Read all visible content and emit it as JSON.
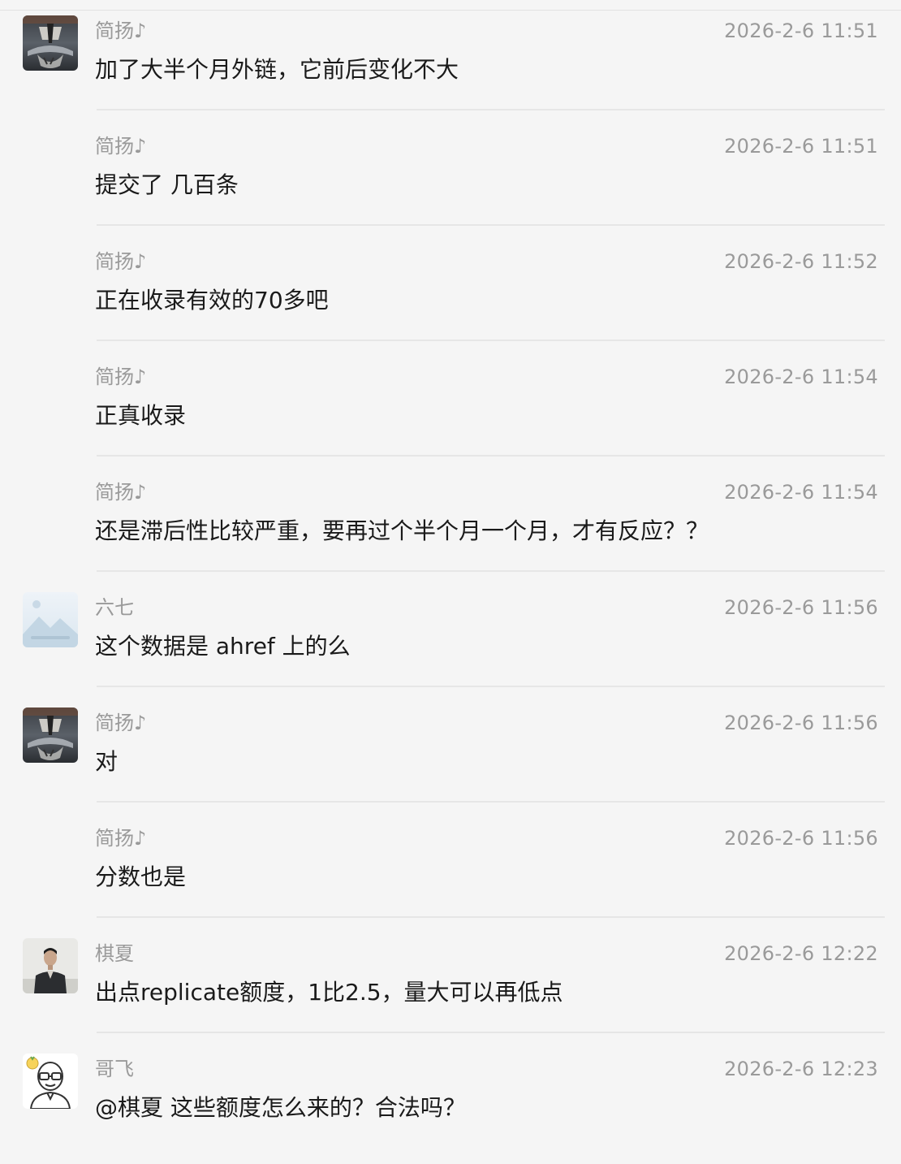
{
  "messages": [
    {
      "name": "简扬♪",
      "time": "2026-2-6 11:51",
      "text": "加了大半个月外链，它前后变化不大",
      "avatar": "tiger-reflection-avatar"
    },
    {
      "name": "简扬♪",
      "time": "2026-2-6 11:51",
      "text": "提交了 几百条",
      "avatar": ""
    },
    {
      "name": "简扬♪",
      "time": "2026-2-6 11:52",
      "text": "正在收录有效的70多吧",
      "avatar": ""
    },
    {
      "name": "简扬♪",
      "time": "2026-2-6 11:54",
      "text": "正真收录",
      "avatar": ""
    },
    {
      "name": "简扬♪",
      "time": "2026-2-6 11:54",
      "text": "还是滞后性比较严重，要再过个半个月一个月，才有反应？？",
      "avatar": ""
    },
    {
      "name": "六七",
      "time": "2026-2-6 11:56",
      "text": "这个数据是 ahref 上的么",
      "avatar": "landscape-placeholder-avatar"
    },
    {
      "name": "简扬♪",
      "time": "2026-2-6 11:56",
      "text": "对",
      "avatar": "tiger-reflection-avatar"
    },
    {
      "name": "简扬♪",
      "time": "2026-2-6 11:56",
      "text": "分数也是",
      "avatar": ""
    },
    {
      "name": "棋夏",
      "time": "2026-2-6 12:22",
      "text": "出点replicate额度，1比2.5，量大可以再低点",
      "avatar": "man-photo-avatar"
    },
    {
      "name": "哥飞",
      "time": "2026-2-6 12:23",
      "text": "@棋夏 这些额度怎么来的？合法吗？",
      "avatar": "cartoon-glasses-avatar"
    }
  ],
  "colors": {
    "background": "#f5f5f5",
    "meta_text": "#9a9a9a",
    "body_text": "#1a1a1a",
    "divider": "#e6e6e6"
  }
}
